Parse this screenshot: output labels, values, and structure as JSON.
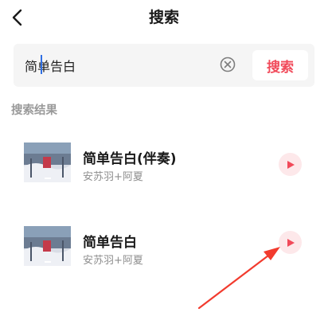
{
  "header": {
    "title": "搜索",
    "back_icon": "chevron-left-icon"
  },
  "search": {
    "value": "简单告白",
    "clear_icon": "clear-circle-icon",
    "button_label": "搜索",
    "accent_color": "#f14a5a"
  },
  "results": {
    "section_label": "搜索结果",
    "items": [
      {
        "title": "简单告白(伴奏)",
        "artist": "安苏羽+阿夏",
        "play_icon": "play-icon"
      },
      {
        "title": "简单告白",
        "artist": "安苏羽+阿夏",
        "play_icon": "play-icon"
      }
    ]
  },
  "annotation": {
    "arrow_color": "#f23b2e",
    "icon": "arrow-annotation"
  }
}
